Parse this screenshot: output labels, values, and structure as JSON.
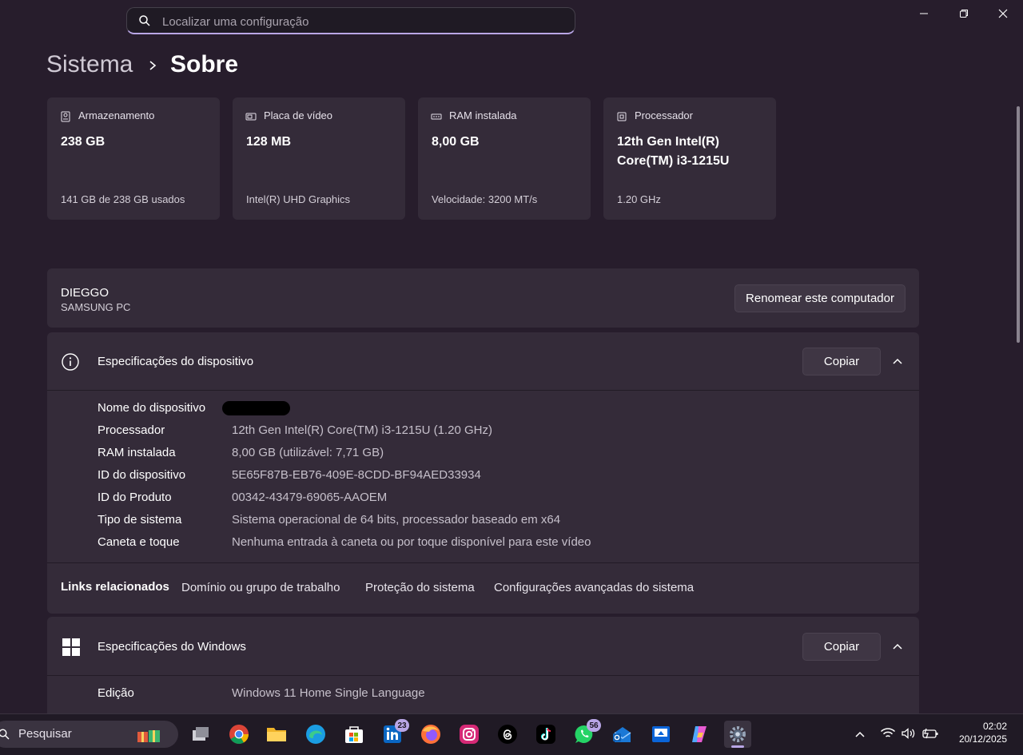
{
  "search": {
    "placeholder": "Localizar uma configuração"
  },
  "breadcrumb": {
    "parent": "Sistema",
    "current": "Sobre"
  },
  "cards": [
    {
      "label": "Armazenamento",
      "value": "238 GB",
      "sub": "141 GB de 238 GB usados",
      "icon": "storage-icon"
    },
    {
      "label": "Placa de vídeo",
      "value": "128 MB",
      "sub": "Intel(R) UHD Graphics",
      "icon": "gpu-icon"
    },
    {
      "label": "RAM instalada",
      "value": "8,00 GB",
      "sub": "Velocidade: 3200 MT/s",
      "icon": "ram-icon"
    },
    {
      "label": "Processador",
      "value": "12th Gen Intel(R) Core(TM) i3-1215U",
      "sub": "1.20 GHz",
      "icon": "cpu-icon"
    }
  ],
  "computer": {
    "name": "DIEGGO",
    "model": "SAMSUNG PC",
    "rename_label": "Renomear este computador"
  },
  "device_specs": {
    "title": "Especificações do dispositivo",
    "copy_label": "Copiar",
    "rows": [
      {
        "key": "Nome do dispositivo",
        "value": ""
      },
      {
        "key": "Processador",
        "value": "12th Gen Intel(R) Core(TM) i3-1215U (1.20 GHz)"
      },
      {
        "key": "RAM instalada",
        "value": "8,00 GB (utilizável: 7,71 GB)"
      },
      {
        "key": "ID do dispositivo",
        "value": "5E65F87B-EB76-409E-8CDD-BF94AED33934"
      },
      {
        "key": "ID do Produto",
        "value": "00342-43479-69065-AAOEM"
      },
      {
        "key": "Tipo de sistema",
        "value": "Sistema operacional de 64 bits, processador baseado em x64"
      },
      {
        "key": "Caneta e toque",
        "value": "Nenhuma entrada à caneta ou por toque disponível para este vídeo"
      }
    ]
  },
  "related_links": {
    "title": "Links relacionados",
    "links": [
      "Domínio ou grupo de trabalho",
      "Proteção do sistema",
      "Configurações avançadas do sistema"
    ]
  },
  "windows_specs": {
    "title": "Especificações do Windows",
    "copy_label": "Copiar",
    "rows": [
      {
        "key": "Edição",
        "value": "Windows 11 Home Single Language"
      }
    ]
  },
  "taskbar": {
    "search_label": "Pesquisar",
    "linkedin_badge": "23",
    "whatsapp_badge": "56",
    "time": "02:02",
    "date": "20/12/2025"
  },
  "colors": {
    "accent": "#b9a6e6",
    "background": "#271d2c",
    "card": "#342b39"
  }
}
